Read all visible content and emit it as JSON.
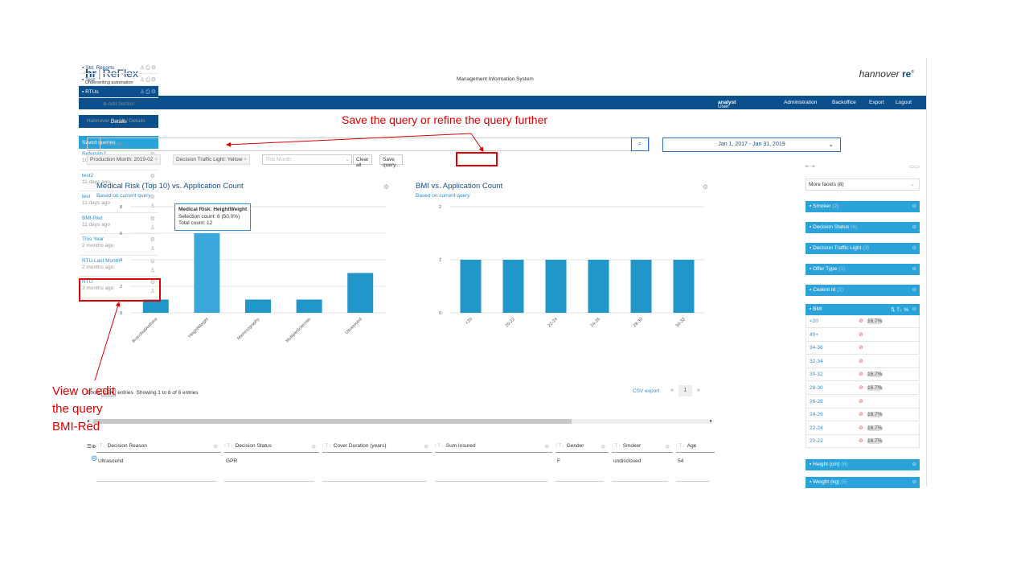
{
  "header": {
    "logo_hr": "hr",
    "logo_name": "ReFlex",
    "logo_sub": "Underwriting automation",
    "title": "Management Information System",
    "brand": "hannover",
    "brand_re": "re"
  },
  "nav": {
    "user_profile_label": "User Profile:",
    "user_profile_value": "analyst",
    "items": [
      "Administration",
      "Backoffice",
      "Export",
      "Logout"
    ]
  },
  "sidebar": {
    "sections": [
      "Std. Reports",
      "Test",
      "RTUs"
    ],
    "add_section": "Add Section",
    "details": "Details",
    "saved_header": "Saved queries",
    "saved": [
      {
        "name": "Referrals2",
        "age": "10 days ago"
      },
      {
        "name": "test2",
        "age": "11 days ago"
      },
      {
        "name": "test",
        "age": "11 days ago"
      },
      {
        "name": "BMI-Red",
        "age": "11 days ago"
      },
      {
        "name": "This Year",
        "age": "2 months ago"
      },
      {
        "name": "RTU Last Month",
        "age": "2 months ago"
      },
      {
        "name": "RTU",
        "age": "3 months ago"
      }
    ]
  },
  "main": {
    "breadcrumb": "Hannover Re MI / Details",
    "search_help": "?",
    "search_placeholder": "Search...",
    "date_range": "Jan 1, 2017 - Jan 31, 2019",
    "chips": [
      "Production Month: 2019-02",
      "Decision Traffic Light: Yellow"
    ],
    "chip_close": "×",
    "month_placeholder": "This Month",
    "clear_all": "Clear all",
    "save_query": "Save query..."
  },
  "chart_data": [
    {
      "type": "bar",
      "title": "Medical Risk (Top 10) vs. Application Count",
      "subtitle": "Based on current query",
      "categories": [
        "BronchialAsthma",
        "HeightWeight",
        "Mammography",
        "MultipleSclerosis",
        "Ultrasound"
      ],
      "values": [
        1,
        6,
        1,
        1,
        3
      ],
      "yticks": [
        0,
        2,
        4,
        6,
        8
      ],
      "ylim": [
        0,
        8
      ],
      "color": "#2196c9",
      "highlight_color": "#3ba8dc",
      "tooltip": {
        "title": "Medical Risk: HeightWeight",
        "line1": "Selection count: 6 (50.0%)",
        "line2": "Total count: 12"
      }
    },
    {
      "type": "bar",
      "title": "BMI vs. Application Count",
      "subtitle": "Based on current query",
      "categories": [
        "<20",
        "20-22",
        "22-24",
        "24-26",
        "28-30",
        "30-32"
      ],
      "values": [
        1,
        1,
        1,
        1,
        1,
        1
      ],
      "yticks": [
        0,
        1,
        2
      ],
      "ylim": [
        0,
        2
      ],
      "color": "#2196c9"
    }
  ],
  "table": {
    "show_label": "Show",
    "page_size": "25",
    "entries_label": "entries",
    "info": "Showing 1 to 6 of 6 entries",
    "csv_export": "CSV export",
    "prev": "«",
    "page": "1",
    "next": "»",
    "type_glyph": "T↓",
    "headers": [
      "Decision Reason",
      "Decision Status",
      "Cover Duration (years)",
      "Sum Insured",
      "Gender",
      "Smoker",
      "Age"
    ],
    "row": [
      "Ultrasound",
      "GPR",
      "",
      "",
      "F",
      "undisclosed",
      "54"
    ]
  },
  "facets": {
    "more": "More facets (8)",
    "items": [
      {
        "name": "Smoker",
        "count": "(2)"
      },
      {
        "name": "Decision Status",
        "count": "(4)"
      },
      {
        "name": "Decision Traffic Light",
        "count": "(3)"
      },
      {
        "name": "Offer Type",
        "count": "(1)"
      },
      {
        "name": "Cedent Id",
        "count": "(1)"
      }
    ],
    "bmi_header": "BMI",
    "bmi_tools": "⇅  T↓  %",
    "bmi_rows": [
      {
        "label": "<20",
        "pct": "16.7%"
      },
      {
        "label": "40+",
        "pct": ""
      },
      {
        "label": "34-36",
        "pct": ""
      },
      {
        "label": "32-34",
        "pct": ""
      },
      {
        "label": "30-32",
        "pct": "16.7%"
      },
      {
        "label": "28-30",
        "pct": "16.7%"
      },
      {
        "label": "26-28",
        "pct": ""
      },
      {
        "label": "24-26",
        "pct": "16.7%"
      },
      {
        "label": "22-24",
        "pct": "16.7%"
      },
      {
        "label": "20-22",
        "pct": "16.7%"
      }
    ],
    "after": [
      {
        "name": "Height (cm)",
        "count": "(6)"
      },
      {
        "name": "Weight (kg)",
        "count": "(6)"
      }
    ]
  },
  "annotations": {
    "top": "Save the query or refine the query further",
    "left": [
      "View or edit",
      "the query",
      "BMI-Red"
    ],
    "color": "#e00000"
  }
}
